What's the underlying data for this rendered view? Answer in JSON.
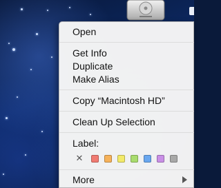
{
  "menu": {
    "open_label": "Open",
    "get_info_label": "Get Info",
    "duplicate_label": "Duplicate",
    "make_alias_label": "Make Alias",
    "copy_label": "Copy “Macintosh HD”",
    "clean_up_label": "Clean Up Selection",
    "label_title": "Label:",
    "more_label": "More",
    "label_colors": [
      "#f07b72",
      "#f6b25a",
      "#f2ea6a",
      "#a9dc6e",
      "#69a7ef",
      "#c98fe6",
      "#a8a8a8"
    ]
  },
  "icons": {
    "no_label": "×-icon",
    "submenu": "triangle-right-icon",
    "desktop_item": "hard-drive-icon"
  }
}
